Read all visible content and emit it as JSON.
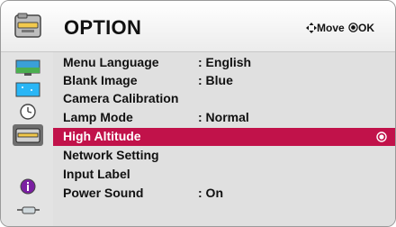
{
  "header": {
    "title": "OPTION",
    "icon": "toolbox-icon",
    "move_hint": "Move",
    "ok_hint": "OK"
  },
  "sidebar": {
    "icons": [
      "picture-icon",
      "screen-icon",
      "clock-icon",
      "option-icon",
      "info-icon",
      "input-icon"
    ],
    "selected": "option-icon"
  },
  "menu": {
    "items": [
      {
        "label": "Menu Language",
        "value": ": English"
      },
      {
        "label": "Blank Image",
        "value": ": Blue"
      },
      {
        "label": "Camera Calibration",
        "value": ""
      },
      {
        "label": "Lamp Mode",
        "value": ": Normal"
      },
      {
        "label": "High Altitude",
        "value": ""
      },
      {
        "label": "Network Setting",
        "value": ""
      },
      {
        "label": "Input Label",
        "value": ""
      },
      {
        "label": "Power Sound",
        "value": ": On"
      }
    ],
    "highlighted": "High Altitude"
  },
  "colors": {
    "highlight": "#c1124a",
    "panel": "#e0e0e0",
    "text": "#111111"
  }
}
